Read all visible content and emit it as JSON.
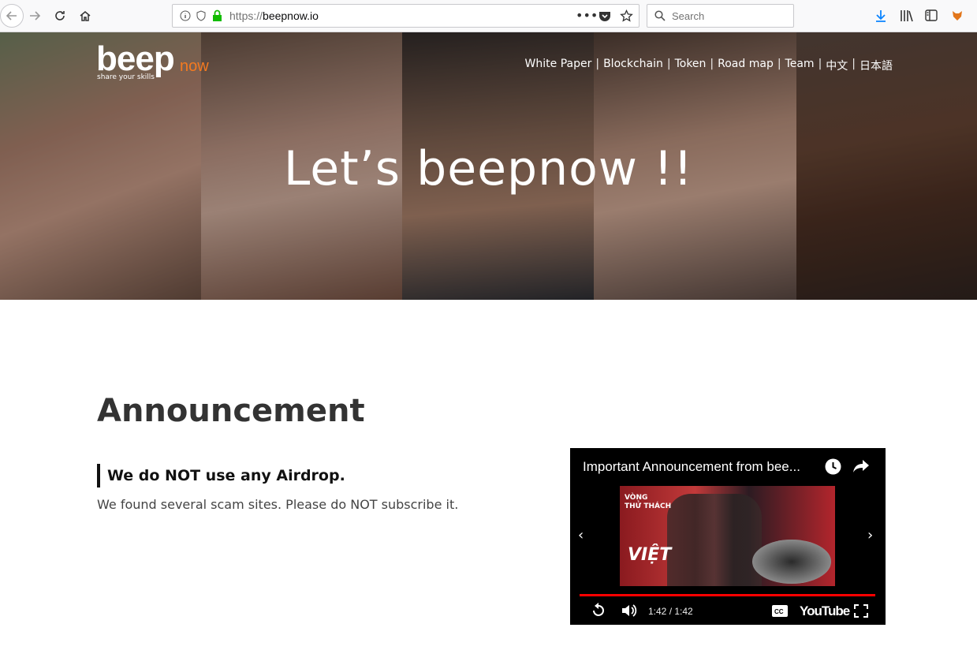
{
  "browser": {
    "url_scheme": "https://",
    "url_host": "beepnow.io",
    "search_placeholder": "Search"
  },
  "site": {
    "logo_text": "beep",
    "logo_now": "now",
    "logo_tagline": "share your skills",
    "nav": [
      "White Paper",
      "Blockchain",
      "Token",
      "Road map",
      "Team",
      "中文",
      "日本語"
    ],
    "hero_title": "Let’s beepnow !!"
  },
  "announcement": {
    "title": "Announcement",
    "heading": "We do NOT use any Airdrop.",
    "body": "We found several scam sites. Please do NOT subscribe it."
  },
  "video": {
    "title": "Important Announcement from bee...",
    "time": "1:42 / 1:42",
    "progress": 1.0,
    "brand": "YouTube",
    "thumb_text_1": "VÒNG",
    "thumb_text_2": "THỬ THÁCH",
    "thumb_text_3": "VIỆT"
  },
  "colors": {
    "accent_orange": "#f47a20",
    "progress_red": "#ff0000",
    "secure_green": "#12bc00"
  }
}
